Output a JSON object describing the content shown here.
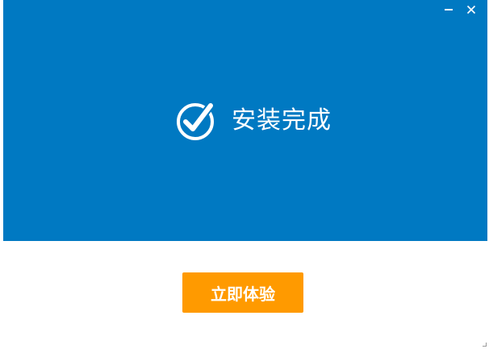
{
  "window": {
    "controls": {
      "minimize_icon": "minimize-icon",
      "close_icon": "close-icon"
    }
  },
  "banner": {
    "background_color": "#0079c2",
    "status_icon": "check-circle-icon",
    "status_text": "安装完成"
  },
  "action": {
    "button_label": "立即体验",
    "button_color": "#ff9a00"
  }
}
